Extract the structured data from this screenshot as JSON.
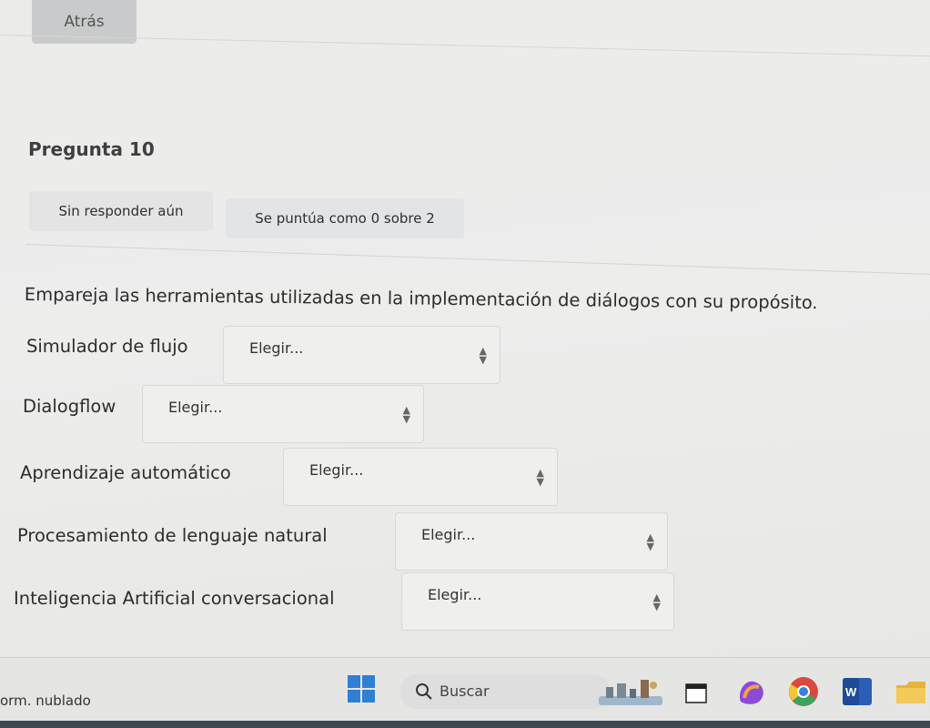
{
  "nav": {
    "back_label": "Atrás"
  },
  "question": {
    "title": "Pregunta 10",
    "status": "Sin responder aún",
    "grade": "Se puntúa como 0 sobre 2",
    "prompt": "Empareja las herramientas utilizadas en la implementación de diálogos con su propósito."
  },
  "matches": [
    {
      "label": "Simulador de flujo",
      "selected": "Elegir..."
    },
    {
      "label": "Dialogflow",
      "selected": "Elegir..."
    },
    {
      "label": "Aprendizaje automático",
      "selected": "Elegir..."
    },
    {
      "label": "Procesamiento de lenguaje natural",
      "selected": "Elegir..."
    },
    {
      "label": "Inteligencia Artificial conversacional",
      "selected": "Elegir..."
    }
  ],
  "taskbar": {
    "weather": "orm. nublado",
    "search_placeholder": "Buscar",
    "icons": [
      "windows-start-icon",
      "search-icon",
      "city-widget-icon",
      "file-explorer-icon",
      "copilot-icon",
      "chrome-icon",
      "word-icon",
      "folder-icon"
    ]
  },
  "colors": {
    "start_blue": "#2f7fd6",
    "word_blue": "#2b5eb6",
    "copilot_purple": "#8c4ad9",
    "chrome_green": "#3ea35a"
  }
}
